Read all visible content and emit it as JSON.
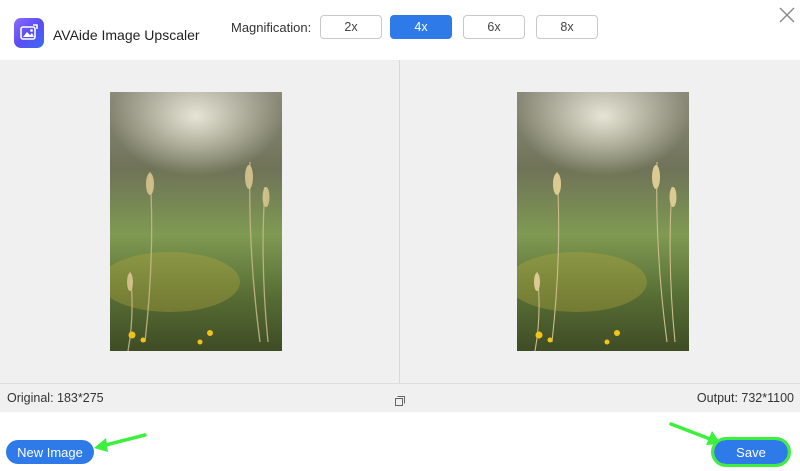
{
  "app": {
    "title": "AVAide Image Upscaler",
    "logo_icon": "image-upscale-icon"
  },
  "magnification": {
    "label": "Magnification:",
    "options": [
      "2x",
      "4x",
      "6x",
      "8x"
    ],
    "selected": "4x"
  },
  "window": {
    "close_icon": "close-icon"
  },
  "preview": {
    "original_label": "Original: 183*275",
    "output_label": "Output: 732*1100",
    "compare_icon": "compare-icon"
  },
  "actions": {
    "new_image_label": "New Image",
    "save_label": "Save"
  },
  "colors": {
    "accent": "#2d7ae8",
    "highlight": "#3ef03e",
    "panel_bg": "#f0f0f0"
  }
}
